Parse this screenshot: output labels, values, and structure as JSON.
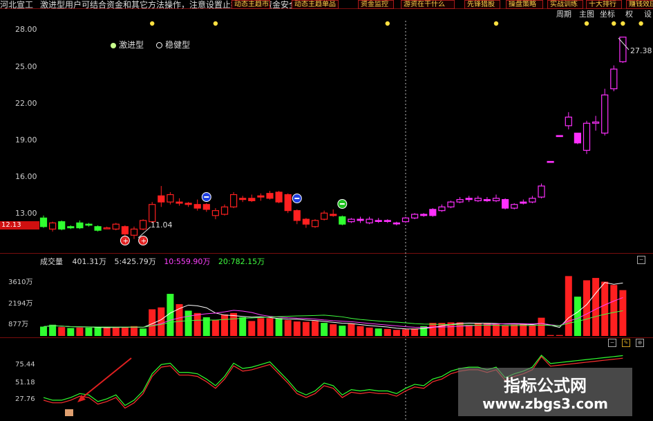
{
  "header": {
    "stock_name": "河北宣工",
    "notice": "激进型用户可结合资金和其它方法操作，注意设置止损，保证资金安全",
    "tabs": [
      "动态主趋市场",
      "动态主趋单品",
      "资金监控",
      "游资在干什么",
      "先锋猎股",
      "操盘策略",
      "实战训练",
      "十大排行",
      "赚钱效应"
    ],
    "controls": [
      "周期",
      "主图",
      "坐标",
      "权",
      "设"
    ]
  },
  "price_axis": [
    "28.00",
    "25.00",
    "22.00",
    "19.00",
    "16.00",
    "13.00"
  ],
  "current_price": "12.13",
  "legend": [
    {
      "label": "激进型",
      "color": "#c8ff8c"
    },
    {
      "label": "稳健型",
      "color": "#ffffff"
    }
  ],
  "annotations": {
    "low_price": "11.04",
    "high_price": "27.38"
  },
  "volume": {
    "title": "成交量",
    "current": "401.31万",
    "ma5": "5:425.79万",
    "ma10": "10:559.90万",
    "ma20": "20:782.15万",
    "y_labels": [
      "3610万",
      "2194万",
      "877万"
    ]
  },
  "indicator": {
    "y_labels": [
      "75.44",
      "51.18",
      "27.76"
    ]
  },
  "watermark": {
    "line1": "指标公式网",
    "line2": "www.zbgs3.com"
  },
  "colors": {
    "up": "#ff2020",
    "down": "#30ff30",
    "magenta": "#ff30ff",
    "background": "#000000",
    "grid": "#7a0d0d"
  },
  "chart_data": {
    "type": "candlestick",
    "y_range": [
      10.5,
      28.5
    ],
    "candles": [
      {
        "o": 12.7,
        "c": 12.0,
        "h": 12.9,
        "l": 11.9,
        "col": "down"
      },
      {
        "o": 12.3,
        "c": 11.8,
        "h": 12.4,
        "l": 11.6,
        "col": "up_hollow"
      },
      {
        "o": 12.4,
        "c": 11.8,
        "h": 12.5,
        "l": 11.7,
        "col": "down"
      },
      {
        "o": 11.9,
        "c": 12.0,
        "h": 12.1,
        "l": 11.8,
        "col": "down"
      },
      {
        "o": 11.9,
        "c": 12.3,
        "h": 12.5,
        "l": 11.8,
        "col": "down"
      },
      {
        "o": 12.2,
        "c": 12.2,
        "h": 12.3,
        "l": 12.0,
        "col": "down"
      },
      {
        "o": 12.0,
        "c": 11.7,
        "h": 12.1,
        "l": 11.6,
        "col": "down"
      },
      {
        "o": 11.9,
        "c": 11.9,
        "h": 12.0,
        "l": 11.8,
        "col": "up_hollow"
      },
      {
        "o": 11.8,
        "c": 12.2,
        "h": 12.3,
        "l": 11.7,
        "col": "up_hollow"
      },
      {
        "o": 12.0,
        "c": 11.4,
        "h": 12.1,
        "l": 11.0,
        "col": "up"
      },
      {
        "o": 11.3,
        "c": 11.8,
        "h": 12.0,
        "l": 11.0,
        "col": "up_hollow"
      },
      {
        "o": 11.8,
        "c": 12.5,
        "h": 12.6,
        "l": 11.7,
        "col": "up_hollow"
      },
      {
        "o": 12.4,
        "c": 13.8,
        "h": 14.0,
        "l": 12.3,
        "col": "up_hollow"
      },
      {
        "o": 14.0,
        "c": 14.5,
        "h": 15.3,
        "l": 13.6,
        "col": "up"
      },
      {
        "o": 14.0,
        "c": 14.6,
        "h": 14.8,
        "l": 13.8,
        "col": "up_hollow"
      },
      {
        "o": 14.0,
        "c": 13.9,
        "h": 14.3,
        "l": 13.7,
        "col": "up"
      },
      {
        "o": 13.8,
        "c": 13.9,
        "h": 14.0,
        "l": 13.6,
        "col": "up"
      },
      {
        "o": 13.5,
        "c": 13.8,
        "h": 14.2,
        "l": 13.3,
        "col": "up"
      },
      {
        "o": 13.8,
        "c": 13.4,
        "h": 13.9,
        "l": 13.2,
        "col": "up"
      },
      {
        "o": 13.3,
        "c": 12.9,
        "h": 13.5,
        "l": 12.6,
        "col": "up_hollow"
      },
      {
        "o": 13.0,
        "c": 13.6,
        "h": 13.8,
        "l": 12.9,
        "col": "up_hollow"
      },
      {
        "o": 13.6,
        "c": 14.6,
        "h": 14.8,
        "l": 13.5,
        "col": "up_hollow"
      },
      {
        "o": 14.3,
        "c": 14.2,
        "h": 14.5,
        "l": 14.0,
        "col": "up"
      },
      {
        "o": 14.1,
        "c": 14.3,
        "h": 14.6,
        "l": 14.0,
        "col": "up"
      },
      {
        "o": 14.4,
        "c": 14.5,
        "h": 14.7,
        "l": 14.1,
        "col": "up"
      },
      {
        "o": 14.3,
        "c": 14.7,
        "h": 14.9,
        "l": 14.2,
        "col": "up"
      },
      {
        "o": 14.8,
        "c": 14.0,
        "h": 14.9,
        "l": 13.9,
        "col": "up"
      },
      {
        "o": 14.6,
        "c": 13.3,
        "h": 14.7,
        "l": 13.1,
        "col": "up"
      },
      {
        "o": 13.3,
        "c": 12.5,
        "h": 13.4,
        "l": 12.2,
        "col": "up"
      },
      {
        "o": 12.6,
        "c": 12.2,
        "h": 12.7,
        "l": 11.9,
        "col": "up"
      },
      {
        "o": 12.0,
        "c": 12.5,
        "h": 12.6,
        "l": 11.9,
        "col": "up_hollow"
      },
      {
        "o": 12.6,
        "c": 13.1,
        "h": 13.3,
        "l": 12.5,
        "col": "up_hollow"
      },
      {
        "o": 13.0,
        "c": 12.9,
        "h": 13.4,
        "l": 12.8,
        "col": "up"
      },
      {
        "o": 12.8,
        "c": 12.2,
        "h": 12.9,
        "l": 12.1,
        "col": "down"
      },
      {
        "o": 12.4,
        "c": 12.6,
        "h": 12.7,
        "l": 12.3,
        "col": "magenta_hollow"
      },
      {
        "o": 12.6,
        "c": 12.5,
        "h": 12.8,
        "l": 12.3,
        "col": "magenta"
      },
      {
        "o": 12.3,
        "c": 12.6,
        "h": 12.8,
        "l": 12.2,
        "col": "magenta_hollow"
      },
      {
        "o": 12.5,
        "c": 12.5,
        "h": 12.7,
        "l": 12.3,
        "col": "magenta"
      },
      {
        "o": 12.5,
        "c": 12.5,
        "h": 12.6,
        "l": 12.3,
        "col": "magenta"
      },
      {
        "o": 12.3,
        "c": 12.3,
        "h": 12.4,
        "l": 12.1,
        "col": "magenta"
      },
      {
        "o": 12.4,
        "c": 12.7,
        "h": 12.8,
        "l": 12.3,
        "col": "magenta_hollow"
      },
      {
        "o": 12.7,
        "c": 13.0,
        "h": 13.1,
        "l": 12.6,
        "col": "magenta_hollow"
      },
      {
        "o": 13.0,
        "c": 12.9,
        "h": 13.1,
        "l": 12.8,
        "col": "magenta"
      },
      {
        "o": 12.9,
        "c": 13.4,
        "h": 13.5,
        "l": 12.8,
        "col": "magenta"
      },
      {
        "o": 13.3,
        "c": 13.6,
        "h": 13.8,
        "l": 13.2,
        "col": "magenta_hollow"
      },
      {
        "o": 13.6,
        "c": 14.0,
        "h": 14.1,
        "l": 13.5,
        "col": "magenta_hollow"
      },
      {
        "o": 14.0,
        "c": 14.2,
        "h": 14.4,
        "l": 13.9,
        "col": "magenta_hollow"
      },
      {
        "o": 14.2,
        "c": 14.3,
        "h": 14.5,
        "l": 14.0,
        "col": "magenta"
      },
      {
        "o": 14.1,
        "c": 14.3,
        "h": 14.5,
        "l": 14.0,
        "col": "magenta_hollow"
      },
      {
        "o": 14.2,
        "c": 14.1,
        "h": 14.4,
        "l": 14.0,
        "col": "magenta"
      },
      {
        "o": 14.1,
        "c": 14.3,
        "h": 14.6,
        "l": 14.0,
        "col": "magenta_hollow"
      },
      {
        "o": 14.2,
        "c": 13.5,
        "h": 14.3,
        "l": 13.4,
        "col": "magenta"
      },
      {
        "o": 13.5,
        "c": 13.8,
        "h": 13.9,
        "l": 13.4,
        "col": "magenta_hollow"
      },
      {
        "o": 13.9,
        "c": 14.0,
        "h": 14.2,
        "l": 13.8,
        "col": "magenta"
      },
      {
        "o": 14.0,
        "c": 14.3,
        "h": 14.5,
        "l": 13.9,
        "col": "magenta_hollow"
      },
      {
        "o": 14.4,
        "c": 15.3,
        "h": 15.5,
        "l": 14.3,
        "col": "magenta_hollow"
      },
      {
        "o": 17.3,
        "c": 17.3,
        "h": 17.3,
        "l": 17.3,
        "col": "magenta"
      },
      {
        "o": 19.4,
        "c": 19.4,
        "h": 19.4,
        "l": 19.4,
        "col": "magenta"
      },
      {
        "o": 20.2,
        "c": 20.9,
        "h": 21.3,
        "l": 19.9,
        "col": "magenta_hollow"
      },
      {
        "o": 19.6,
        "c": 18.8,
        "h": 19.6,
        "l": 18.7,
        "col": "magenta"
      },
      {
        "o": 18.2,
        "c": 20.4,
        "h": 20.6,
        "l": 17.9,
        "col": "magenta_hollow"
      },
      {
        "o": 20.4,
        "c": 20.5,
        "h": 21.0,
        "l": 19.8,
        "col": "magenta_hollow"
      },
      {
        "o": 19.6,
        "c": 22.7,
        "h": 23.2,
        "l": 19.4,
        "col": "magenta_hollow"
      },
      {
        "o": 23.2,
        "c": 24.8,
        "h": 25.1,
        "l": 23.0,
        "col": "magenta_hollow"
      },
      {
        "o": 25.4,
        "c": 27.4,
        "h": 27.4,
        "l": 25.3,
        "col": "magenta_hollow"
      }
    ],
    "volumes": [
      {
        "v": 2.0,
        "col": "down"
      },
      {
        "v": 2.4,
        "col": "down"
      },
      {
        "v": 1.9,
        "col": "up"
      },
      {
        "v": 1.7,
        "col": "down"
      },
      {
        "v": 1.8,
        "col": "up"
      },
      {
        "v": 1.8,
        "col": "down"
      },
      {
        "v": 1.9,
        "col": "down"
      },
      {
        "v": 1.8,
        "col": "up"
      },
      {
        "v": 1.8,
        "col": "up"
      },
      {
        "v": 1.9,
        "col": "up"
      },
      {
        "v": 2.1,
        "col": "up"
      },
      {
        "v": 1.6,
        "col": "down"
      },
      {
        "v": 5.7,
        "col": "up"
      },
      {
        "v": 6.1,
        "col": "up"
      },
      {
        "v": 9.0,
        "col": "down"
      },
      {
        "v": 6.8,
        "col": "up"
      },
      {
        "v": 5.4,
        "col": "down"
      },
      {
        "v": 4.9,
        "col": "up"
      },
      {
        "v": 4.0,
        "col": "down"
      },
      {
        "v": 3.4,
        "col": "up"
      },
      {
        "v": 4.6,
        "col": "up"
      },
      {
        "v": 4.9,
        "col": "up"
      },
      {
        "v": 4.0,
        "col": "down"
      },
      {
        "v": 3.2,
        "col": "up"
      },
      {
        "v": 3.8,
        "col": "up"
      },
      {
        "v": 3.8,
        "col": "up"
      },
      {
        "v": 3.8,
        "col": "down"
      },
      {
        "v": 3.4,
        "col": "up"
      },
      {
        "v": 3.1,
        "col": "up"
      },
      {
        "v": 3.0,
        "col": "up"
      },
      {
        "v": 3.2,
        "col": "up"
      },
      {
        "v": 2.8,
        "col": "down"
      },
      {
        "v": 2.5,
        "col": "up"
      },
      {
        "v": 2.2,
        "col": "down"
      },
      {
        "v": 2.6,
        "col": "up"
      },
      {
        "v": 2.1,
        "col": "up"
      },
      {
        "v": 1.8,
        "col": "up"
      },
      {
        "v": 1.6,
        "col": "down"
      },
      {
        "v": 1.5,
        "col": "up"
      },
      {
        "v": 1.3,
        "col": "up"
      },
      {
        "v": 1.4,
        "col": "up"
      },
      {
        "v": 1.6,
        "col": "up"
      },
      {
        "v": 2.1,
        "col": "down"
      },
      {
        "v": 2.8,
        "col": "up"
      },
      {
        "v": 2.8,
        "col": "up"
      },
      {
        "v": 2.9,
        "col": "up"
      },
      {
        "v": 2.9,
        "col": "up"
      },
      {
        "v": 2.4,
        "col": "up"
      },
      {
        "v": 2.7,
        "col": "up"
      },
      {
        "v": 2.8,
        "col": "up"
      },
      {
        "v": 2.5,
        "col": "up"
      },
      {
        "v": 2.3,
        "col": "up"
      },
      {
        "v": 2.4,
        "col": "up"
      },
      {
        "v": 2.6,
        "col": "up"
      },
      {
        "v": 2.3,
        "col": "up"
      },
      {
        "v": 3.9,
        "col": "up"
      },
      {
        "v": 0.2,
        "col": "up"
      },
      {
        "v": 0.2,
        "col": "up"
      },
      {
        "v": 12.8,
        "col": "up"
      },
      {
        "v": 8.4,
        "col": "down"
      },
      {
        "v": 11.9,
        "col": "up"
      },
      {
        "v": 12.4,
        "col": "up"
      },
      {
        "v": 11.6,
        "col": "up"
      },
      {
        "v": 10.9,
        "col": "up"
      },
      {
        "v": 9.8,
        "col": "up"
      }
    ]
  }
}
